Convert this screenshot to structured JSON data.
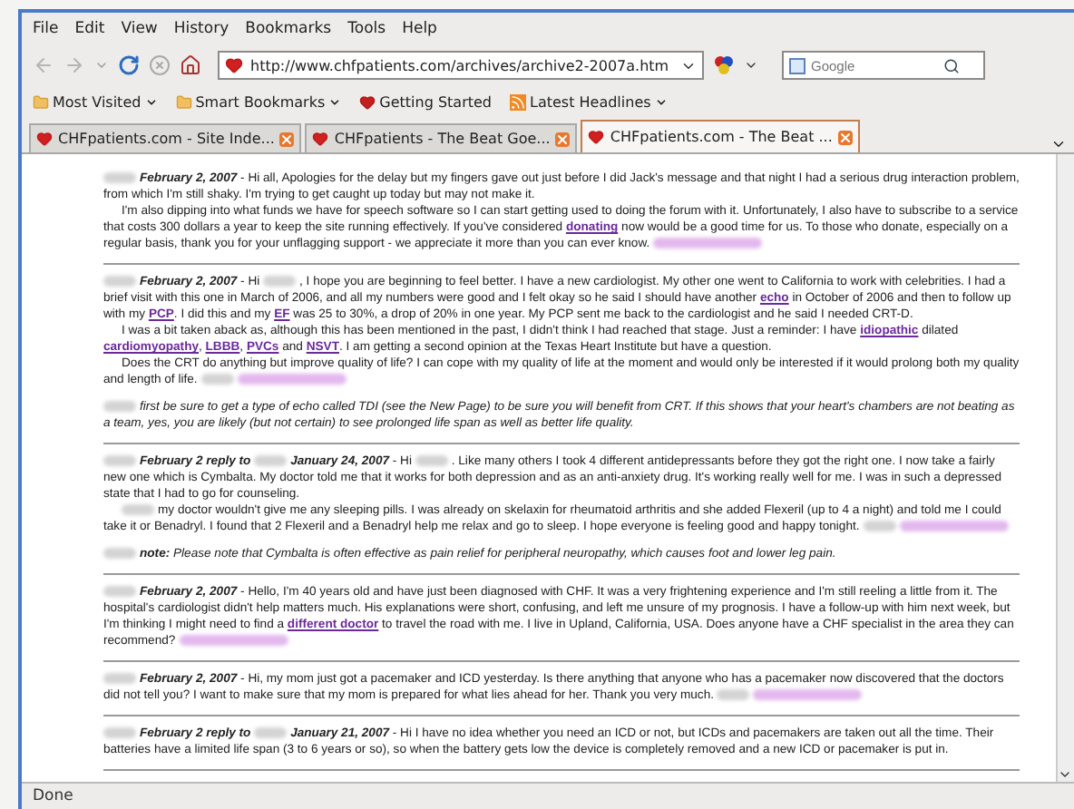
{
  "menu": [
    "File",
    "Edit",
    "View",
    "History",
    "Bookmarks",
    "Tools",
    "Help"
  ],
  "navigation": {
    "url": "http://www.chfpatients.com/archives/archive2-2007a.htm",
    "search": {
      "placeholder": "Google"
    }
  },
  "bookmarks": [
    {
      "label": "Most Visited",
      "kind": "folder"
    },
    {
      "label": "Smart Bookmarks",
      "kind": "folder"
    },
    {
      "label": "Getting Started",
      "kind": "page"
    },
    {
      "label": "Latest Headlines",
      "kind": "feed"
    }
  ],
  "tabs": [
    {
      "title": "CHFpatients.com - Site Inde...",
      "selected": false
    },
    {
      "title": "CHFpatients - The Beat Goe...",
      "selected": false
    },
    {
      "title": "CHFpatients.com - The Beat ...",
      "selected": true
    }
  ],
  "posts": [
    {
      "paragraphs": [
        {
          "kind": "lead",
          "parts": [
            {
              "kind": "redacted"
            },
            {
              "kind": "text",
              "text": "*February 2, 2007* - Hi all, Apologies for the delay but my fingers gave out just before I did Jack's message and that night I had a serious drug interaction problem, from which I'm still shaky. I'm trying to get caught up today but may not make it."
            }
          ]
        },
        {
          "kind": "continued",
          "parts": [
            {
              "kind": "text",
              "text": "I'm also dipping into what funds we have for speech software so I can start getting used to doing the forum with it. Unfortunately, I also have to subscribe to a service that costs 300 dollars a year to keep the site running effectively. If you've considered "
            },
            {
              "kind": "link",
              "text": "donating"
            },
            {
              "kind": "text",
              "text": " now would be a good time for us. To those who donate, especially on a regular basis, thank you for your unflagging support - we appreciate it more than you can ever know. "
            },
            {
              "kind": "redacted_link"
            }
          ]
        }
      ]
    },
    {
      "paragraphs": [
        {
          "kind": "lead",
          "parts": [
            {
              "kind": "redacted"
            },
            {
              "kind": "text",
              "text": "*February 2, 2007* - Hi "
            },
            {
              "kind": "redacted"
            },
            {
              "kind": "text",
              "text": ", I hope you are beginning to feel better. I have a new cardiologist. My other one went to California to work with celebrities. I had a brief visit with this one in March of 2006, and all my numbers were good and I felt okay so he said I should have another "
            },
            {
              "kind": "link",
              "text": "echo"
            },
            {
              "kind": "text",
              "text": " in October of 2006 and then to follow up with my "
            },
            {
              "kind": "link",
              "text": "PCP"
            },
            {
              "kind": "text",
              "text": ". I did this and my "
            },
            {
              "kind": "link",
              "text": "EF"
            },
            {
              "kind": "text",
              "text": " was 25 to 30%, a drop of 20% in one year. My PCP sent me back to the cardiologist and he said I needed CRT-D."
            }
          ]
        },
        {
          "kind": "continued",
          "parts": [
            {
              "kind": "text",
              "text": "I was a bit taken aback as, although this has been mentioned in the past, I didn't think I had reached that stage. Just a reminder: I have "
            },
            {
              "kind": "link",
              "text": "idiopathic"
            },
            {
              "kind": "text",
              "text": " dilated "
            },
            {
              "kind": "link",
              "text": "cardiomyopathy"
            },
            {
              "kind": "text",
              "text": ", "
            },
            {
              "kind": "link",
              "text": "LBBB"
            },
            {
              "kind": "text",
              "text": ", "
            },
            {
              "kind": "link",
              "text": "PVCs"
            },
            {
              "kind": "text",
              "text": " and "
            },
            {
              "kind": "link",
              "text": "NSVT"
            },
            {
              "kind": "text",
              "text": ". I am getting a second opinion at the Texas Heart Institute but have a question."
            }
          ]
        },
        {
          "kind": "continued",
          "parts": [
            {
              "kind": "text",
              "text": "Does the CRT do anything but improve quality of life? I can cope with my quality of life at the moment and would only be interested if it would prolong both my quality and length of life. "
            },
            {
              "kind": "redacted"
            },
            {
              "kind": "redacted_link"
            }
          ]
        },
        {
          "kind": "reply",
          "parts": [
            {
              "kind": "redacted"
            },
            {
              "kind": "text",
              "text": "first be sure to get a type of echo called TDI (see the New Page) to be sure you will benefit from CRT. If this shows that your heart's chambers are not beating as a team, yes, you are likely (but not certain) to see prolonged life span as well as better life quality."
            }
          ]
        }
      ]
    },
    {
      "paragraphs": [
        {
          "kind": "lead",
          "parts": [
            {
              "kind": "redacted"
            },
            {
              "kind": "text",
              "text": "*February 2 reply to* "
            },
            {
              "kind": "redacted"
            },
            {
              "kind": "text",
              "text": "*January 24, 2007* - Hi "
            },
            {
              "kind": "redacted"
            },
            {
              "kind": "text",
              "text": ". Like many others I took 4 different antidepressants before they got the right one. I now take a fairly new one which is Cymbalta. My doctor told me that it works for both depression and as an anti-anxiety drug. It's working really well for me. I was in such a depressed state that I had to go for counseling."
            }
          ]
        },
        {
          "kind": "continued",
          "parts": [
            {
              "kind": "redacted"
            },
            {
              "kind": "text",
              "text": "my doctor wouldn't give me any sleeping pills. I was already on skelaxin for rheumatoid arthritis and she added Flexeril (up to 4 a night) and told me I could take it or Benadryl. I found that 2 Flexeril and a Benadryl help me relax and go to sleep. I hope everyone is feeling good and happy tonight. "
            },
            {
              "kind": "redacted"
            },
            {
              "kind": "redacted_link"
            }
          ]
        },
        {
          "kind": "reply",
          "parts": [
            {
              "kind": "redacted"
            },
            {
              "kind": "text",
              "text": "**note:** Please note that Cymbalta is often effective as pain relief for peripheral neuropathy, which causes foot and lower leg pain."
            }
          ]
        }
      ]
    },
    {
      "paragraphs": [
        {
          "kind": "lead",
          "parts": [
            {
              "kind": "redacted"
            },
            {
              "kind": "text",
              "text": "*February 2, 2007* - Hello, I'm 40 years old and have just been diagnosed with CHF. It was a very frightening experience and I'm still reeling a little from it. The hospital's cardiologist didn't help matters much. His explanations were short, confusing, and left me unsure of my prognosis. I have a follow-up with him next week, but I'm thinking I might need to find a "
            },
            {
              "kind": "link",
              "text": "different doctor"
            },
            {
              "kind": "text",
              "text": " to travel the road with me. I live in Upland, California, USA. Does anyone have a CHF specialist in the area they can recommend? "
            },
            {
              "kind": "redacted_link"
            }
          ]
        }
      ]
    },
    {
      "paragraphs": [
        {
          "kind": "lead",
          "parts": [
            {
              "kind": "redacted"
            },
            {
              "kind": "text",
              "text": "*February 2, 2007* - Hi, my mom just got a pacemaker and ICD yesterday. Is there anything that anyone who has a pacemaker now discovered that the doctors did not tell you? I want to make sure that my mom is prepared for what lies ahead for her. Thank you very much. "
            },
            {
              "kind": "redacted"
            },
            {
              "kind": "redacted_link"
            }
          ]
        }
      ]
    },
    {
      "paragraphs": [
        {
          "kind": "lead",
          "parts": [
            {
              "kind": "redacted"
            },
            {
              "kind": "text",
              "text": "*February 2 reply to* "
            },
            {
              "kind": "redacted"
            },
            {
              "kind": "text",
              "text": "*January 21, 2007* - Hi I have no idea whether you need an ICD or not, but ICDs and pacemakers are taken out all the time. Their batteries have a limited life span (3 to 6 years or so), so when the battery gets low the device is completely removed and a new ICD or pacemaker is put in."
            }
          ]
        }
      ]
    }
  ],
  "status_bar": "Done"
}
